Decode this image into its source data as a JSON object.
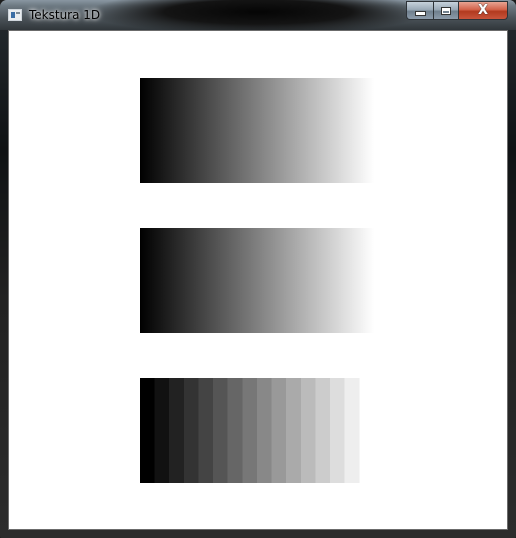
{
  "window": {
    "title": "Tekstura 1D",
    "icon": "app-window-icon"
  },
  "caption_buttons": {
    "minimize_icon": "minimize-icon",
    "maximize_icon": "maximize-icon",
    "close_icon": "close-icon",
    "close_glyph": "X"
  },
  "gradients": [
    {
      "name": "smooth",
      "from": "#000000",
      "to": "#ffffff",
      "steps": 0
    },
    {
      "name": "smooth",
      "from": "#000000",
      "to": "#ffffff",
      "steps": 0
    },
    {
      "name": "stepped",
      "from": "#000000",
      "to": "#ffffff",
      "steps": 16
    }
  ]
}
